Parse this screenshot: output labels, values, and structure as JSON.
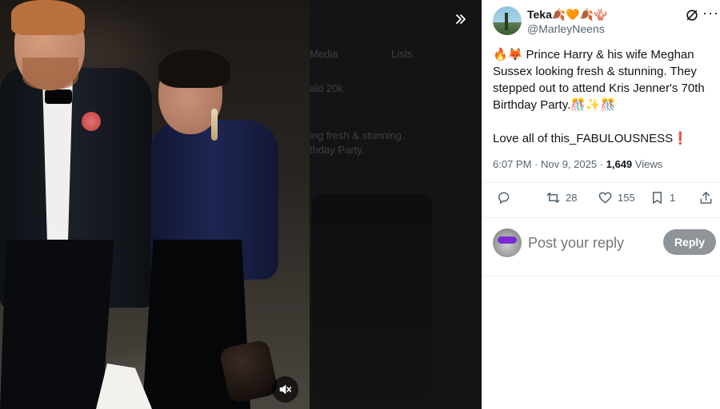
{
  "media": {
    "expand_icon": "double-chevron-right-icon",
    "mute_icon": "speaker-muted-icon",
    "backdrop_ghost_text": {
      "tab_media": "Media",
      "tab_lists": "Lists",
      "date_fragment": "ald 20k",
      "line1": "ing fresh & stunning.",
      "line2": "thday Party."
    }
  },
  "tweet": {
    "author": {
      "display_name": "Teka🍂🧡🍂🪸",
      "handle": "@MarleyNeens"
    },
    "text_line_1": "🔥🦊 Prince Harry & his wife Meghan Sussex looking fresh & stunning. They stepped out to attend Kris Jenner's 70th Birthday Party.🎊✨🎊",
    "text_line_2": "Love all of this_FABULOUSNESS❗",
    "time": "6:07 PM · Nov 9, 2025 · ",
    "views_count": "1,649",
    "views_label": " Views",
    "actions": {
      "reply_count": "",
      "retweet_count": "28",
      "like_count": "155",
      "bookmark_count": "1"
    }
  },
  "reply": {
    "placeholder": "Post your reply",
    "button_label": "Reply"
  },
  "colors": {
    "text_primary": "#0f1419",
    "text_secondary": "#536471",
    "reply_button_bg": "#8f9499",
    "divider": "#eff3f4"
  }
}
